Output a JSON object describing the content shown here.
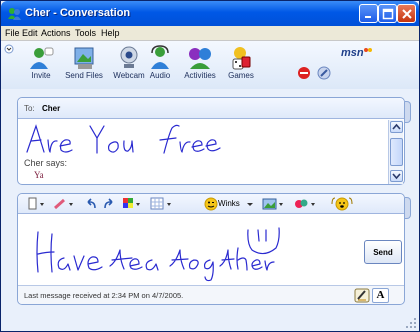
{
  "window": {
    "title": "Cher - Conversation"
  },
  "menu": {
    "items": [
      "File",
      "Edit",
      "Actions",
      "Tools",
      "Help"
    ]
  },
  "toolbar": {
    "buttons": [
      {
        "label": "Invite",
        "icon": "invite-icon"
      },
      {
        "label": "Send Files",
        "icon": "send-files-icon"
      },
      {
        "label": "Webcam",
        "icon": "webcam-icon"
      },
      {
        "label": "Audio",
        "icon": "audio-icon"
      },
      {
        "label": "Activities",
        "icon": "activities-icon"
      },
      {
        "label": "Games",
        "icon": "games-icon"
      }
    ],
    "logo": "msn"
  },
  "conversation": {
    "to_label": "To:",
    "to_name": "Cher",
    "handwriting_text": "Are You free",
    "sender_says": "Cher says:",
    "sender_message": "Ya"
  },
  "compose": {
    "winks_label": "Winks",
    "handwriting_text": "Have tea together",
    "send_label": "Send",
    "font_button": "A"
  },
  "status": {
    "text": "Last message received at 2:34 PM on 4/7/2005."
  },
  "colors": {
    "titlebar": "#0058e6",
    "ink": "#2a2ad0",
    "sender_message": "#7a1a3a",
    "pane_border": "#8aa6d6"
  }
}
